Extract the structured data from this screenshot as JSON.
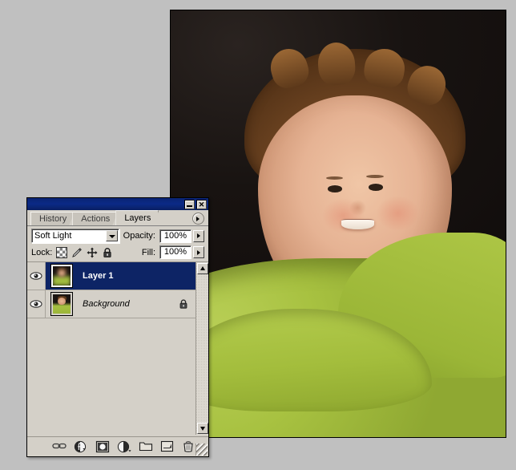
{
  "app": {
    "palette_title": "Layers"
  },
  "titlebar": {
    "minimize_label": "Minimize",
    "close_label": "Close"
  },
  "tabs": [
    {
      "label": "History",
      "active": false
    },
    {
      "label": "Actions",
      "active": false
    },
    {
      "label": "Layers",
      "active": true
    }
  ],
  "palette_menu": {
    "name": "palette-menu",
    "glyph": "▶"
  },
  "blend": {
    "mode_label": "Soft Light",
    "opacity_label": "Opacity:",
    "opacity_value": "100%"
  },
  "lock": {
    "label": "Lock:",
    "fill_label": "Fill:",
    "fill_value": "100%",
    "icons": [
      {
        "name": "lock-transparent-pixels-icon",
        "title": "Lock transparent pixels"
      },
      {
        "name": "lock-image-pixels-icon",
        "title": "Lock image pixels"
      },
      {
        "name": "lock-position-icon",
        "title": "Lock position"
      },
      {
        "name": "lock-all-icon",
        "title": "Lock all"
      }
    ]
  },
  "layers": [
    {
      "name": "Layer 1",
      "selected": true,
      "visible": true,
      "locked": false,
      "italic": false,
      "thumb_blurred": true
    },
    {
      "name": "Background",
      "selected": false,
      "visible": true,
      "locked": true,
      "italic": true,
      "thumb_blurred": false
    }
  ],
  "bottom_tools": [
    {
      "name": "link-layers-icon",
      "label": "Link layers"
    },
    {
      "name": "layer-style-icon",
      "label": "Add a layer style"
    },
    {
      "name": "layer-mask-icon",
      "label": "Add layer mask"
    },
    {
      "name": "adjustment-layer-icon",
      "label": "Create new fill or adjustment layer"
    },
    {
      "name": "new-group-icon",
      "label": "Create a new group"
    },
    {
      "name": "new-layer-icon",
      "label": "Create a new layer"
    },
    {
      "name": "delete-layer-icon",
      "label": "Delete layer"
    }
  ],
  "scrollbar": {
    "up_label": "Scroll up",
    "down_label": "Scroll down"
  },
  "document": {
    "description": "Photograph of a smiling boy in a green sweater against a dark background"
  },
  "colors": {
    "desktop": "#c0c0c0",
    "palette_face": "#d4d0c8",
    "titlebar": "#0b2a86",
    "selection": "#0d2465",
    "sweater_green": "#a8c13f",
    "photo_backdrop": "#15100e"
  }
}
